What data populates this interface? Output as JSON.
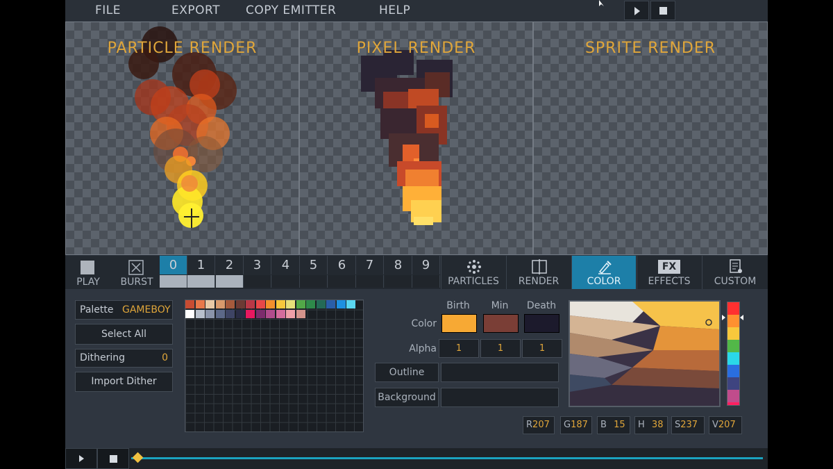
{
  "menu": {
    "file": "FILE",
    "export": "EXPORT",
    "copy_emitter": "COPY EMITTER",
    "help": "HELP"
  },
  "panels": {
    "particle": "PARTICLE RENDER",
    "pixel": "PIXEL RENDER",
    "sprite": "SPRITE RENDER"
  },
  "tools": {
    "play": "PLAY",
    "burst": "BURST"
  },
  "emitters": [
    "0",
    "1",
    "2",
    "3",
    "4",
    "5",
    "6",
    "7",
    "8",
    "9"
  ],
  "emitter_selected": "0",
  "tabs": {
    "particles": "PARTICLES",
    "render": "RENDER",
    "color": "COLOR",
    "effects": "EFFECTS",
    "custom": "CUSTOM",
    "fx_badge": "FX"
  },
  "palette": {
    "label": "Palette",
    "value": "GAMEBOY"
  },
  "select_all": "Select All",
  "dithering": {
    "label": "Dithering",
    "value": "0"
  },
  "import_dither": "Import Dither",
  "palette_colors_row1": [
    "#c84c32",
    "#e8784a",
    "#e9c9a5",
    "#d99a6c",
    "#a65a3c",
    "#6c3a34",
    "#b83846",
    "#e84848",
    "#f4902c",
    "#f8c83c",
    "#e6e07a",
    "#52a848",
    "#2e8a4a",
    "#246a56",
    "#2a5ea8",
    "#1e90e0",
    "#5ad6f0"
  ],
  "palette_colors_row2": [
    "#ffffff",
    "#b8c0cc",
    "#8a94aa",
    "#5c6888",
    "#3e4464",
    "#2a2c44",
    "#e81860",
    "#7c2c6c",
    "#b04c8c",
    "#d46c9c",
    "#f0a0a8",
    "#d4948c"
  ],
  "color_table": {
    "headers": {
      "birth": "Birth",
      "min": "Min",
      "death": "Death"
    },
    "color_label": "Color",
    "alpha_label": "Alpha",
    "colors": {
      "birth": "#f7a934",
      "min": "#7a3e36",
      "death": "#1c1a2c"
    },
    "alpha": {
      "birth": "1",
      "min": "1",
      "death": "1"
    }
  },
  "outline": "Outline",
  "background": "Background",
  "channels": [
    {
      "k": "R",
      "v": "207"
    },
    {
      "k": "G",
      "v": "187"
    },
    {
      "k": "B",
      "v": "15"
    },
    {
      "k": "H",
      "v": "38"
    },
    {
      "k": "S",
      "v": "237"
    },
    {
      "k": "V",
      "v": "207"
    }
  ],
  "colors": {
    "accent": "#e0a63a",
    "active_tab": "#1d7fa8",
    "timeline_line": "#1aa3c0"
  }
}
